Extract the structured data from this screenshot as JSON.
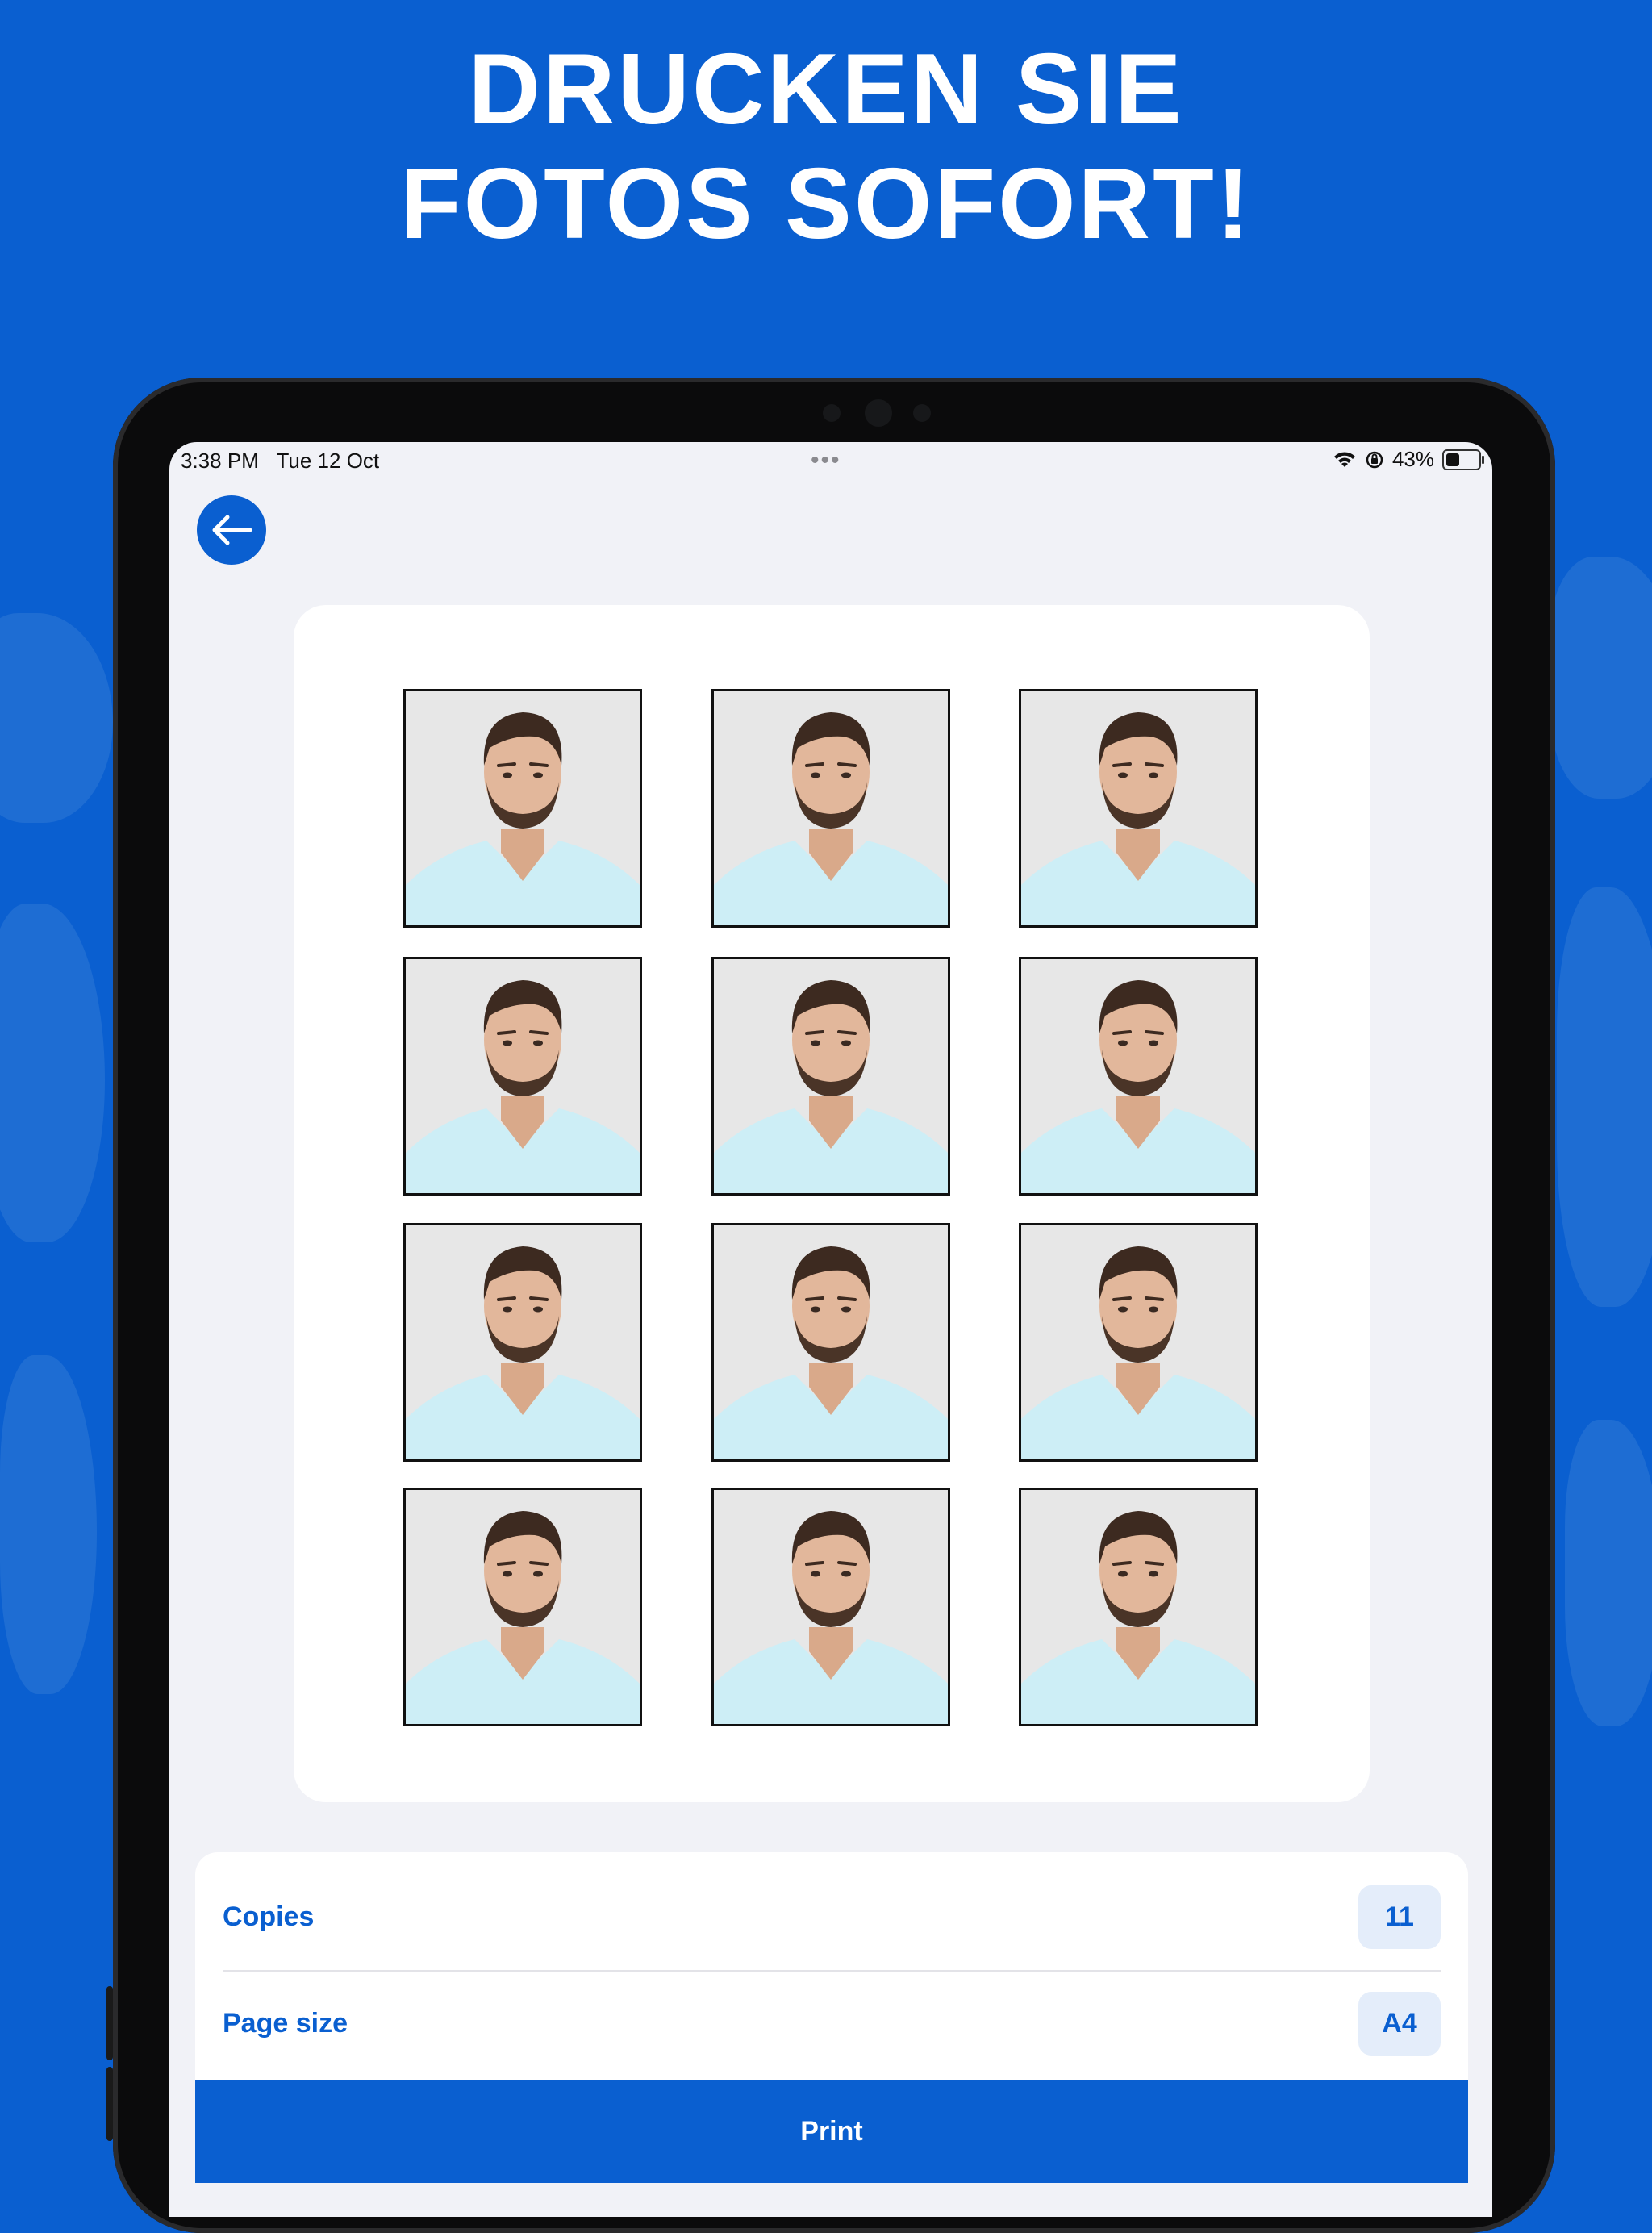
{
  "headline": {
    "line1": "DRUCKEN SIE",
    "line2": "FOTOS SOFORT!"
  },
  "status_bar": {
    "time": "3:38 PM",
    "date": "Tue 12 Oct",
    "battery_text": "43%",
    "battery_level": 0.43
  },
  "nav": {
    "back_icon": "arrow-left-icon"
  },
  "print_sheet": {
    "photo_count": 12,
    "columns": 3,
    "rows": 4
  },
  "settings": {
    "copies": {
      "label": "Copies",
      "value": "11"
    },
    "page_size": {
      "label": "Page size",
      "value": "A4"
    }
  },
  "print_button": {
    "label": "Print"
  },
  "colors": {
    "brand": "#0a5fd0",
    "background": "#f1f2f7",
    "value_chip": "#e4edfa"
  }
}
